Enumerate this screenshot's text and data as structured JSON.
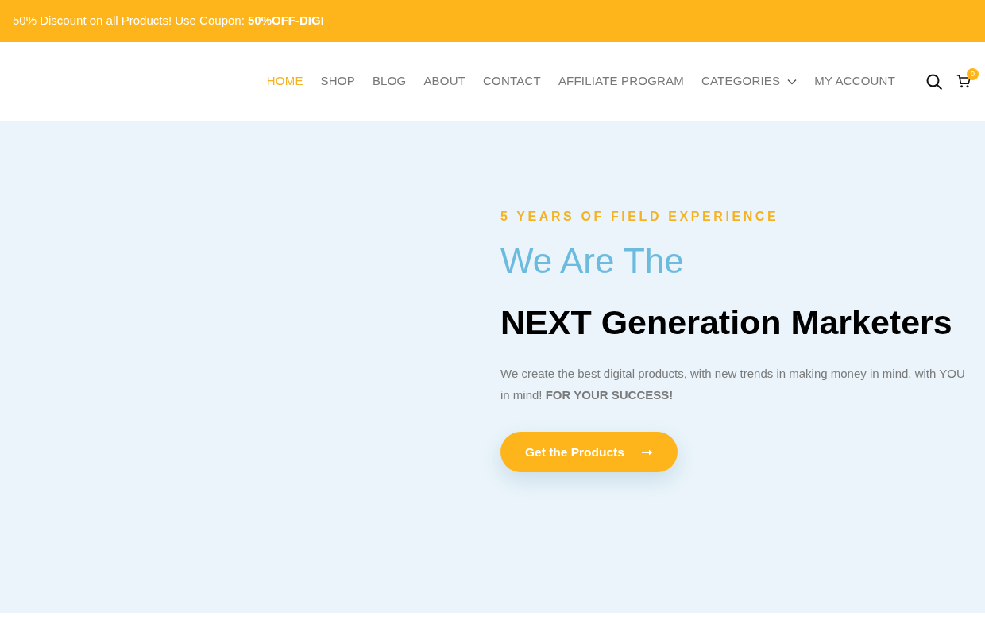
{
  "announcement_bar": {
    "text": "50% Discount on all Products! Use Coupon: **50%OFF-DIGI**"
  },
  "nav": {
    "items": [
      {
        "label": "HOME",
        "kind": "link",
        "selected": true
      },
      {
        "label": "SHOP",
        "kind": "link",
        "selected": false
      },
      {
        "label": "BLOG",
        "kind": "link",
        "selected": false
      },
      {
        "label": "ABOUT",
        "kind": "link",
        "selected": false
      },
      {
        "label": "CONTACT",
        "kind": "link",
        "selected": false
      },
      {
        "label": "AFFILIATE PROGRAM",
        "kind": "link",
        "selected": false
      },
      {
        "label": "CATEGORIES",
        "kind": "dropdown",
        "selected": false
      },
      {
        "label": "MY ACCOUNT",
        "kind": "link",
        "selected": false
      }
    ]
  },
  "cart": {
    "count": "0"
  },
  "hero": {
    "eyebrow": "5 YEARS OF FIELD EXPERIENCE",
    "title_light": "We Are The",
    "title_bold": "NEXT Generation Marketers",
    "description": "We create the best digital products, with new trends in making money in mind, with YOU in mind! **FOR YOUR SUCCESS!**",
    "button": "Get the Products"
  }
}
